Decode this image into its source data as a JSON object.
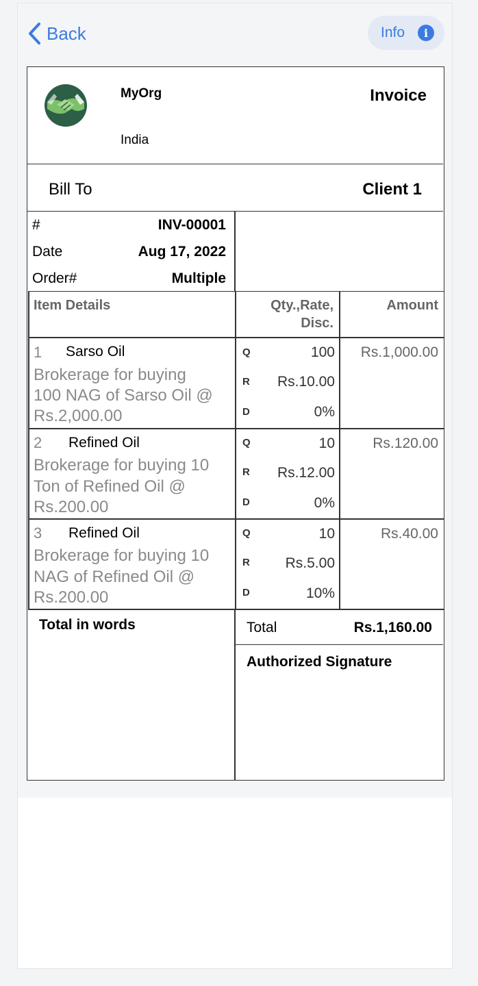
{
  "nav": {
    "back_label": "Back",
    "info_label": "Info",
    "info_icon": "i"
  },
  "org": {
    "name": "MyOrg",
    "country": "India"
  },
  "doc": {
    "title": "Invoice"
  },
  "bill": {
    "label": "Bill To",
    "client": "Client 1"
  },
  "meta": [
    {
      "key": "#",
      "value": "INV-00001"
    },
    {
      "key": "Date",
      "value": "Aug 17, 2022"
    },
    {
      "key": "Order#",
      "value": "Multiple"
    }
  ],
  "table": {
    "headers": {
      "details": "Item Details",
      "qrd_1": "Qty.,Rate,",
      "qrd_2": "Disc.",
      "amount": "Amount"
    },
    "q_label": "Q",
    "r_label": "R",
    "d_label": "D",
    "items": [
      {
        "num": "1",
        "name": "Sarso Oil",
        "desc_1": "Brokerage for buying",
        "desc_2": "100 NAG of Sarso Oil @",
        "desc_3": "Rs.2,000.00",
        "qty": "100",
        "rate": "Rs.10.00",
        "disc": "0%",
        "amount": "Rs.1,000.00"
      },
      {
        "num": "2",
        "name": "Refined Oil",
        "desc_1": "Brokerage for buying 10",
        "desc_2": "Ton of Refined Oil @",
        "desc_3": "Rs.200.00",
        "qty": "10",
        "rate": "Rs.12.00",
        "disc": "0%",
        "amount": "Rs.120.00"
      },
      {
        "num": "3",
        "name": "Refined Oil",
        "desc_1": "Brokerage for buying 10",
        "desc_2": "NAG of Refined Oil @",
        "desc_3": "Rs.200.00",
        "qty": "10",
        "rate": "Rs.5.00",
        "disc": "10%",
        "amount": "Rs.40.00"
      }
    ]
  },
  "footer": {
    "words_label": "Total in words",
    "total_label": "Total",
    "total_value": "Rs.1,160.00",
    "signature_label": "Authorized Signature"
  },
  "colors": {
    "accent": "#3b7be0",
    "info_bg": "#e3e9f5",
    "border": "#333333",
    "muted": "#8a8a8a"
  }
}
